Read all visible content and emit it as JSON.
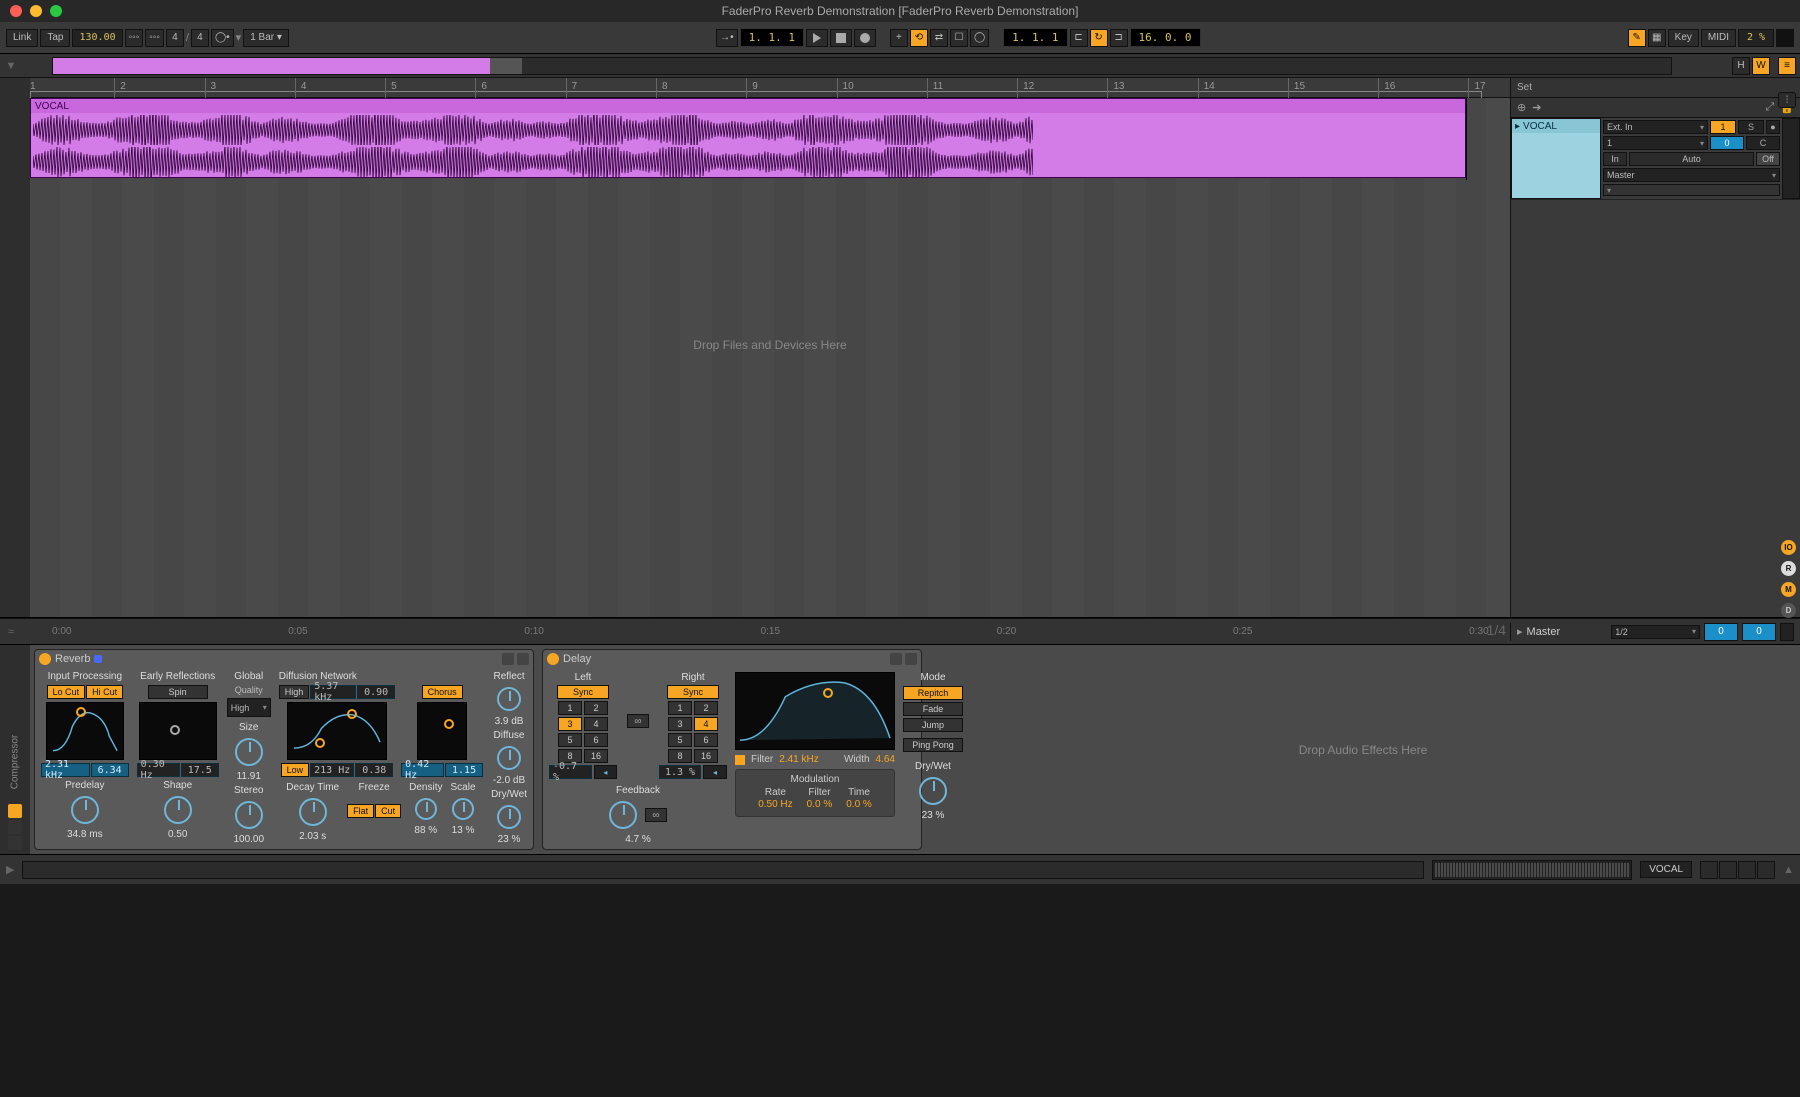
{
  "window": {
    "title": "FaderPro Reverb Demonstration  [FaderPro Reverb Demonstration]"
  },
  "toolbar": {
    "link": "Link",
    "tap": "Tap",
    "tempo": "130.00",
    "sig_num": "4",
    "sig_den": "4",
    "quant": "1 Bar",
    "pos": "1.   1.   1",
    "loop_start": "1.   1.   1",
    "loop_len": "16.   0.   0",
    "key": "Key",
    "midi": "MIDI",
    "cpu": "2 %"
  },
  "overview": {
    "h": "H",
    "w": "W"
  },
  "ruler": {
    "bars": [
      "1",
      "2",
      "3",
      "4",
      "5",
      "6",
      "7",
      "8",
      "9",
      "10",
      "11",
      "12",
      "13",
      "14",
      "15",
      "16",
      "17"
    ]
  },
  "track": {
    "clip_name": "VOCAL"
  },
  "arrange": {
    "drop": "Drop Files and Devices Here"
  },
  "time_ruler": {
    "ticks": [
      "0:00",
      "0:05",
      "0:10",
      "0:15",
      "0:20",
      "0:25",
      "0:30"
    ],
    "zoom": "1/4"
  },
  "set": {
    "label": "Set",
    "track_name": "VOCAL",
    "in_type": "Ext. In",
    "in_ch": "1",
    "monitor": {
      "in": "In",
      "auto": "Auto",
      "off": "Off"
    },
    "out": "Master",
    "send1": "1",
    "s": "S",
    "send0": "0",
    "c": "C"
  },
  "master": {
    "label": "Master",
    "quant": "1/2",
    "a": "0",
    "b": "0"
  },
  "gutter": {
    "compressor": "Compressor"
  },
  "reverb": {
    "title": "Reverb",
    "sections": {
      "input": "Input Processing",
      "early": "Early Reflections",
      "global": "Global",
      "quality": "Quality",
      "diff": "Diffusion Network",
      "reflect": "Reflect",
      "diffuse": "Diffuse",
      "drywet": "Dry/Wet",
      "predelay": "Predelay",
      "shape": "Shape",
      "size": "Size",
      "stereo": "Stereo",
      "decay": "Decay Time",
      "freeze": "Freeze",
      "density": "Density",
      "scale": "Scale"
    },
    "locut": "Lo Cut",
    "hicut": "Hi Cut",
    "spin": "Spin",
    "high": "High",
    "chorus": "Chorus",
    "freeze_flat": "Flat",
    "freeze_cut": "Cut",
    "low": "Low",
    "in_lo": "2.31 kHz",
    "in_hi": "6.34",
    "er_freq": "0.30 Hz",
    "er_amt": "17.5",
    "size": "11.91",
    "dn_hi_freq": "5.37 kHz",
    "dn_hi_amt": "0.90",
    "dn_lo_freq": "213 Hz",
    "dn_lo_amt": "0.38",
    "ch_freq": "0.42 Hz",
    "ch_amt": "1.15",
    "reflect": "3.9 dB",
    "diffuse": "-2.0 dB",
    "predelay": "34.8 ms",
    "shape": "0.50",
    "stereo": "100.00",
    "decay": "2.03 s",
    "density": "88 %",
    "scale": "13 %",
    "drywet": "23 %",
    "quality_sel": "High"
  },
  "delay": {
    "title": "Delay",
    "left": "Left",
    "right": "Right",
    "sync": "Sync",
    "grid": [
      "1",
      "2",
      "3",
      "4",
      "5",
      "6",
      "8",
      "16"
    ],
    "l_active": "3",
    "r_active": "4",
    "l_pct": "-0.7 %",
    "r_pct": "1.3 %",
    "mode_lbl": "Mode",
    "repitch": "Repitch",
    "fade": "Fade",
    "jump": "Jump",
    "pingpong": "Ping Pong",
    "feedback_lbl": "Feedback",
    "feedback": "4.7 %",
    "filter_lbl": "Filter",
    "filter_freq": "2.41 kHz",
    "width_lbl": "Width",
    "width": "4.64",
    "mod_lbl": "Modulation",
    "rate_lbl": "Rate",
    "rate": "0.50 Hz",
    "filt_lbl": "Filter",
    "filt": "0.0 %",
    "time_lbl": "Time",
    "time": "0.0 %",
    "drywet_lbl": "Dry/Wet",
    "drywet": "23 %",
    "link": "∞"
  },
  "fxdrop": "Drop Audio Effects Here",
  "status": {
    "track": "VOCAL"
  }
}
